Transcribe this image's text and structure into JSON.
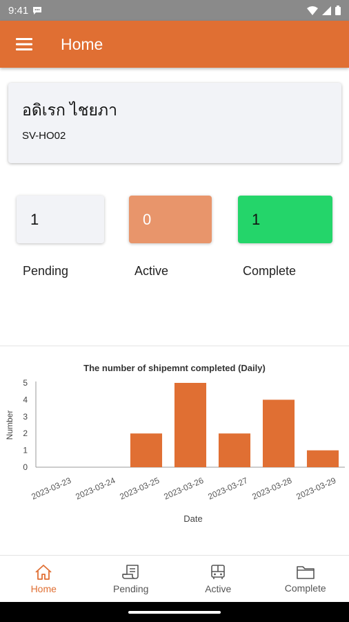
{
  "status_bar": {
    "time": "9:41"
  },
  "app_bar": {
    "title": "Home"
  },
  "profile": {
    "name": "อดิเรก ไชยภา",
    "code": "SV-HO02"
  },
  "stats": [
    {
      "label": "Pending",
      "value": "1"
    },
    {
      "label": "Active",
      "value": "0"
    },
    {
      "label": "Complete",
      "value": "1"
    }
  ],
  "chart_data": {
    "type": "bar",
    "title": "The number of shipemnt completed (Daily)",
    "xlabel": "Date",
    "ylabel": "Number",
    "categories": [
      "2023-03-23",
      "2023-03-24",
      "2023-03-25",
      "2023-03-26",
      "2023-03-27",
      "2023-03-28",
      "2023-03-29"
    ],
    "values": [
      0,
      0,
      2,
      5,
      2,
      4,
      1
    ],
    "ylim": [
      0,
      5
    ],
    "yticks": [
      "0",
      "1",
      "2",
      "3",
      "4",
      "5"
    ],
    "grid": false,
    "color": "#e06f33"
  },
  "bottom_nav": [
    {
      "label": "Home",
      "icon": "home-icon",
      "active": true
    },
    {
      "label": "Pending",
      "icon": "pending-icon",
      "active": false
    },
    {
      "label": "Active",
      "icon": "truck-icon",
      "active": false
    },
    {
      "label": "Complete",
      "icon": "folder-icon",
      "active": false
    }
  ],
  "colors": {
    "primary": "#e06f33",
    "active_box": "#e8956b",
    "complete_box": "#24d56a",
    "card": "#f2f3f7"
  }
}
